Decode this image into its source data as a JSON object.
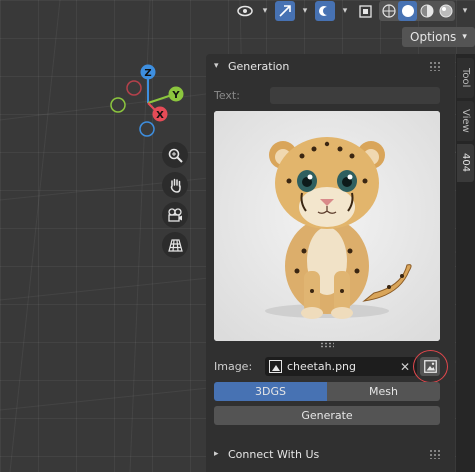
{
  "toolbar": {
    "options_label": "Options",
    "icons": [
      "visibility-icon",
      "gizmo-icon",
      "overlay-icon",
      "xray-icon",
      "wireframe-shading",
      "solid-shading",
      "material-shading",
      "rendered-shading"
    ]
  },
  "gizmo": {
    "z": "Z",
    "y": "Y",
    "x": "X"
  },
  "nav_buttons": [
    "zoom-icon",
    "hand-pan-icon",
    "camera-icon",
    "grid-perspective-icon"
  ],
  "generation": {
    "title": "Generation",
    "text_label": "Text:",
    "text_value": "",
    "image_label": "Image:",
    "image_name": "cheetah.png",
    "modes": [
      "3DGS",
      "Mesh"
    ],
    "active_mode": "3DGS",
    "generate_label": "Generate"
  },
  "connect": {
    "title": "Connect With Us"
  },
  "tabs": [
    "Tool",
    "View",
    "404"
  ],
  "active_tab": "404",
  "colors": {
    "accent": "#4772b3",
    "highlight": "#e0474c",
    "x_axis": "#e54b57",
    "y_axis": "#8cc63e",
    "z_axis": "#3e8fe0"
  }
}
